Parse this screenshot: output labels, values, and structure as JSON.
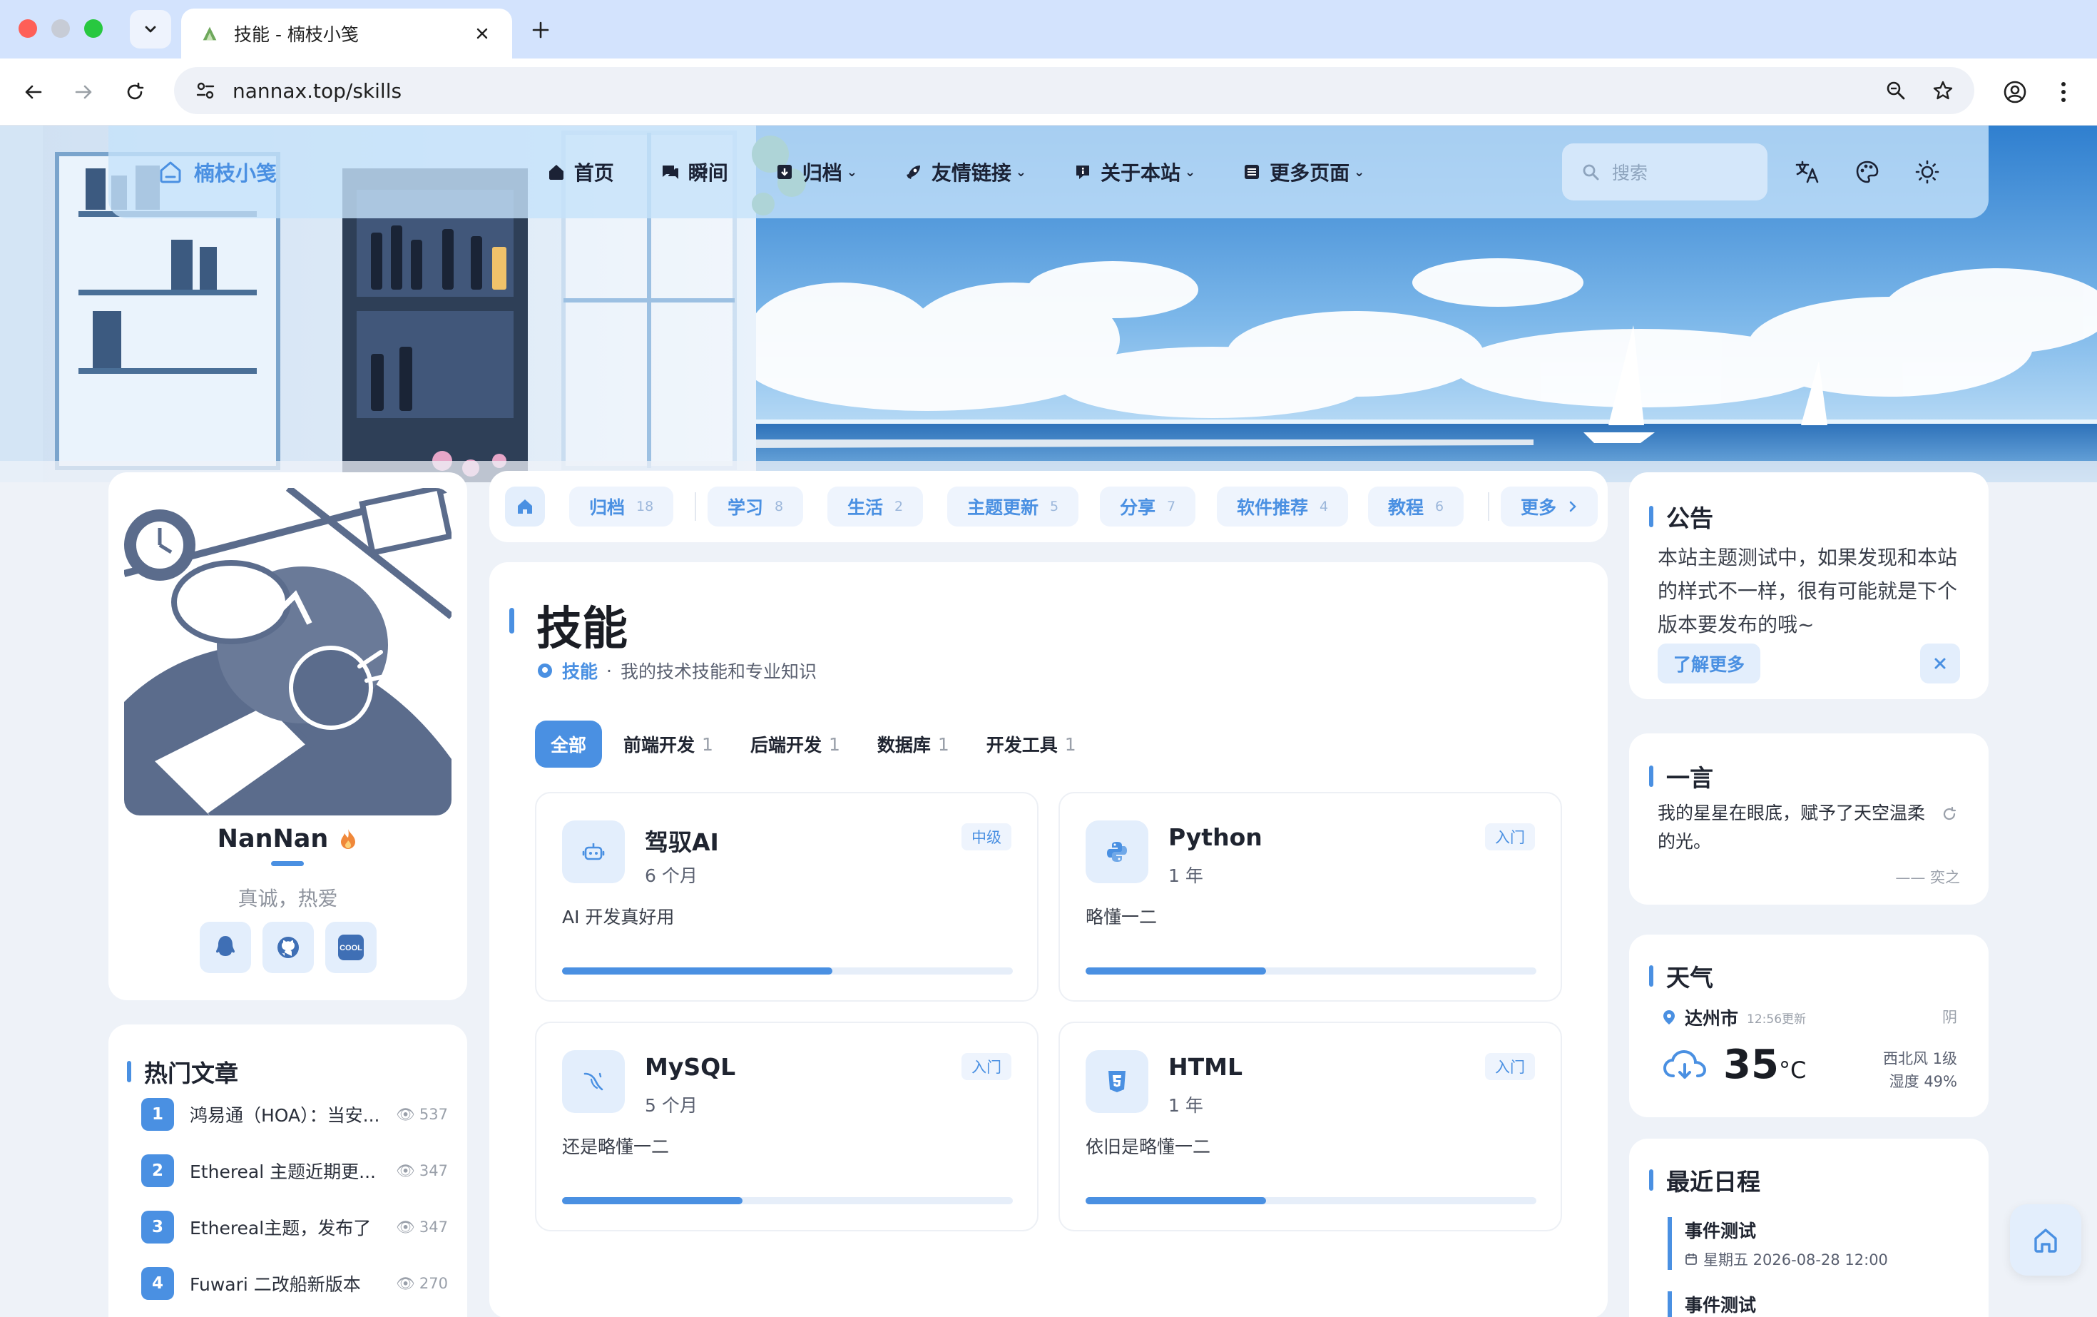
{
  "browser": {
    "tab_title": "技能 - 楠枝小笺",
    "url": "nannax.top/skills"
  },
  "site": {
    "brand": "楠枝小笺",
    "nav": [
      {
        "label": "首页",
        "icon": "home-icon",
        "dropdown": false
      },
      {
        "label": "瞬间",
        "icon": "chat-icon",
        "dropdown": false
      },
      {
        "label": "归档",
        "icon": "archive-icon",
        "dropdown": true
      },
      {
        "label": "友情链接",
        "icon": "rocket-icon",
        "dropdown": true
      },
      {
        "label": "关于本站",
        "icon": "info-icon",
        "dropdown": true
      },
      {
        "label": "更多页面",
        "icon": "list-icon",
        "dropdown": true
      }
    ],
    "search_placeholder": "搜索"
  },
  "profile": {
    "name": "NanNan",
    "bio": "真诚，热爱",
    "social": [
      "qq-icon",
      "github-icon",
      "coolapk-icon"
    ],
    "cool_label": "COOL"
  },
  "hot_posts": {
    "title": "热门文章",
    "items": [
      {
        "rank": "1",
        "title": "鸿易通（HOA）：当安...",
        "views": "537"
      },
      {
        "rank": "2",
        "title": "Ethereal 主题近期更...",
        "views": "347"
      },
      {
        "rank": "3",
        "title": "Ethereal主题，发布了",
        "views": "347"
      },
      {
        "rank": "4",
        "title": "Fuwari 二改船新版本",
        "views": "270"
      }
    ]
  },
  "categories": [
    {
      "label": "归档",
      "count": "18"
    },
    {
      "label": "学习",
      "count": "8"
    },
    {
      "label": "生活",
      "count": "2"
    },
    {
      "label": "主题更新",
      "count": "5"
    },
    {
      "label": "分享",
      "count": "7"
    },
    {
      "label": "软件推荐",
      "count": "4"
    },
    {
      "label": "教程",
      "count": "6"
    }
  ],
  "more_label": "更多",
  "main": {
    "title": "技能",
    "breadcrumb_link": "技能",
    "breadcrumb_sep": "·",
    "breadcrumb_desc": "我的技术技能和专业知识",
    "filters": [
      {
        "label": "全部",
        "count": "",
        "active": true
      },
      {
        "label": "前端开发",
        "count": "1",
        "active": false
      },
      {
        "label": "后端开发",
        "count": "1",
        "active": false
      },
      {
        "label": "数据库",
        "count": "1",
        "active": false
      },
      {
        "label": "开发工具",
        "count": "1",
        "active": false
      }
    ],
    "skills": [
      {
        "name": "驾驭AI",
        "duration": "6 个月",
        "level": "中级",
        "desc": "AI 开发真好用",
        "progress": 0.6,
        "icon": "robot-icon"
      },
      {
        "name": "Python",
        "duration": "1 年",
        "level": "入门",
        "desc": "略懂一二",
        "progress": 0.4,
        "icon": "python-icon"
      },
      {
        "name": "MySQL",
        "duration": "5 个月",
        "level": "入门",
        "desc": "还是略懂一二",
        "progress": 0.4,
        "icon": "mysql-icon"
      },
      {
        "name": "HTML",
        "duration": "1 年",
        "level": "入门",
        "desc": "依旧是略懂一二",
        "progress": 0.4,
        "icon": "html5-icon"
      }
    ]
  },
  "notice": {
    "title": "公告",
    "text": "本站主题测试中，如果发现和本站的样式不一样，很有可能就是下个版本要发布的哦~",
    "button": "了解更多"
  },
  "quote": {
    "title": "一言",
    "text": "我的星星在眼底，赋予了天空温柔的光。",
    "author": "—— 奕之"
  },
  "weather": {
    "title": "天气",
    "city": "达州市",
    "updated": "12:56更新",
    "condition": "阴",
    "temperature": "35",
    "unit": "°C",
    "wind": "西北风 1级",
    "humidity": "湿度 49%"
  },
  "schedule": {
    "title": "最近日程",
    "events": [
      {
        "title": "事件测试",
        "date": "星期五 2026-08-28 12:00"
      },
      {
        "title": "事件测试",
        "date": ""
      }
    ]
  },
  "colors": {
    "accent": "#4a90e2",
    "accent_light": "#e3eefc",
    "page_bg": "#eef2f8"
  }
}
